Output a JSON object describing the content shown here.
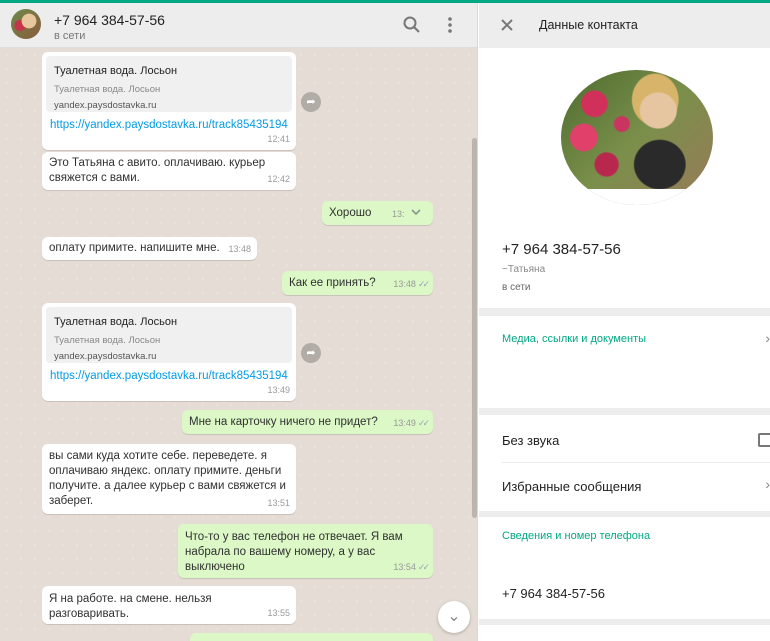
{
  "chat": {
    "contact_name": "+7 964 384-57-56",
    "status": "в сети",
    "icons": {
      "search": "search-icon",
      "menu": "menu-icon",
      "scroll_down": "chevron-down-icon",
      "forward": "forward-icon"
    },
    "messages": [
      {
        "type": "in",
        "preview_title": "Туалетная вода. Лосьон",
        "preview_desc": "Туалетная вода. Лосьон",
        "preview_domain": "yandex.paysdostavka.ru",
        "link": "https://yandex.paysdostavka.ru/track85435194",
        "time": "12:41"
      },
      {
        "type": "in",
        "line1": "Это Татьяна с авито. оплачиваю. курьер",
        "line2": "свяжется с вами.",
        "time": "12:42"
      },
      {
        "type": "out",
        "text": "Хорошо",
        "time": "13:"
      },
      {
        "type": "in",
        "text": "оплату примите. напишите мне.",
        "time": "13:48"
      },
      {
        "type": "out",
        "text": "Как ее принять?",
        "time": "13:48"
      },
      {
        "type": "in",
        "preview_title": "Туалетная вода. Лосьон",
        "preview_desc": "Туалетная вода. Лосьон",
        "preview_domain": "yandex.paysdostavka.ru",
        "link": "https://yandex.paysdostavka.ru/track85435194",
        "time": "13:49"
      },
      {
        "type": "out",
        "text": "Мне на карточку ничего не придет?",
        "time": "13:49"
      },
      {
        "type": "in",
        "line1": "вы сами куда хотите себе. переведете. я",
        "line2": "оплачиваю яндекс. оплату примите. деньги",
        "line3": "получите.  а далее курьер с вами свяжется и",
        "line4": "заберет.",
        "time": "13:51"
      },
      {
        "type": "out",
        "line1": "Что-то у вас телефон не отвечает. Я вам",
        "line2": "набрала по вашему номеру, а у вас выключено",
        "time": "13:54"
      },
      {
        "type": "in",
        "text": "Я на работе. на смене. нельзя разговаривать.",
        "time": "13:55"
      }
    ]
  },
  "contact": {
    "title": "Данные контакта",
    "phone": "+7 964 384-57-56",
    "alias": "~Татьяна",
    "status": "в сети",
    "media_label": "Медиа, ссылки и документы",
    "mute_label": "Без звука",
    "starred_label": "Избранные сообщения",
    "about_label": "Сведения и номер телефона",
    "phone_value": "+7 964 384-57-56",
    "icons": {
      "close": "close-icon",
      "chevron": "chevron-right-icon"
    }
  },
  "colors": {
    "accent": "#00a884",
    "incoming": "#ffffff",
    "outgoing": "#dcf8c6",
    "link": "#039be5",
    "chat_bg": "#e5ddd5"
  }
}
